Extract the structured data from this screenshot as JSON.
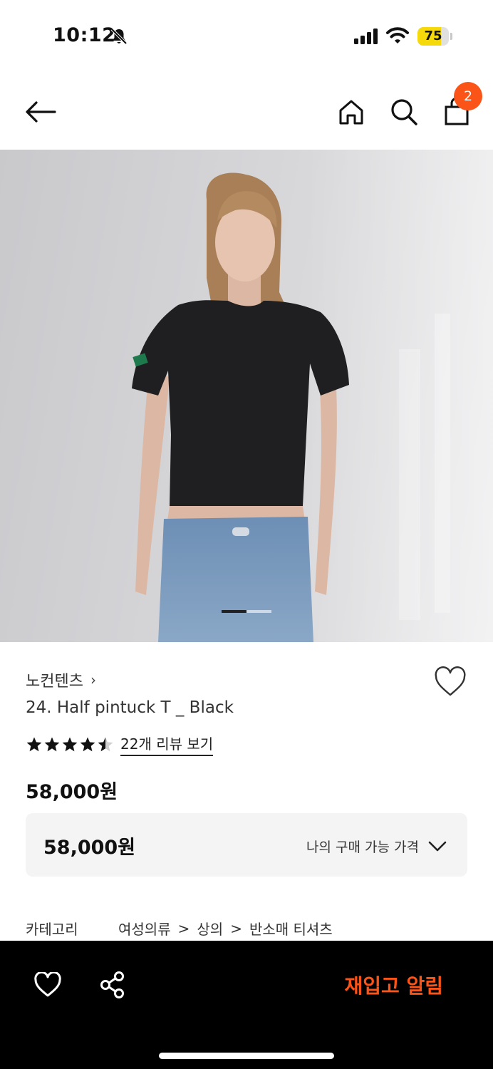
{
  "status_bar": {
    "time": "10:12",
    "battery": "75",
    "battery_level": 0.75,
    "battery_color": "#f5d90a"
  },
  "nav": {
    "cart_count": "2",
    "badge_color": "#fb5418"
  },
  "gallery": {
    "current_page": 1,
    "total_pages": 2
  },
  "product": {
    "brand": "노컨텐츠",
    "brand_chevron": "›",
    "title": "24. Half pintuck T _ Black",
    "rating": 4.5,
    "review_link": "22개 리뷰 보기",
    "price": "58,000원",
    "my_price": "58,000원",
    "my_price_label": "나의 구매 가능 가격"
  },
  "category": {
    "label": "카테고리",
    "path": [
      "여성의류",
      "상의",
      "반소매 티셔츠"
    ],
    "separator": ">"
  },
  "bottom_bar": {
    "restock_label": "재입고 알림",
    "accent_color": "#fb5418"
  }
}
